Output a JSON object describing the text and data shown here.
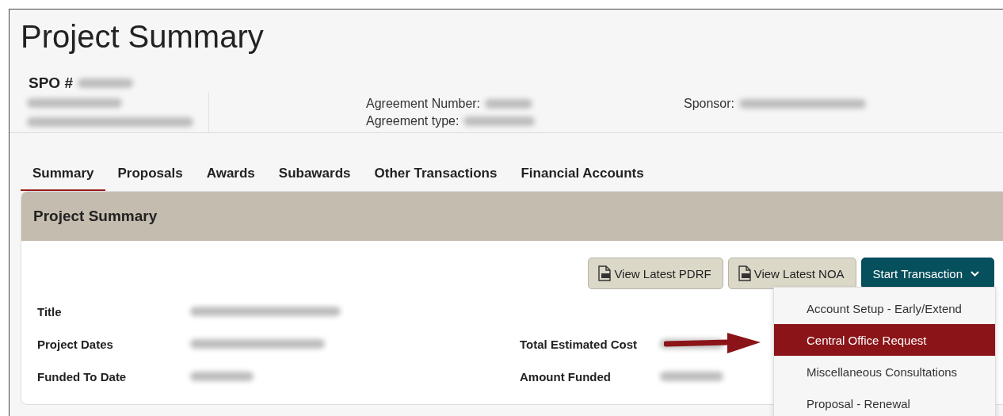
{
  "page": {
    "title": "Project Summary"
  },
  "header": {
    "spo_label": "SPO #",
    "agreement_fields": [
      {
        "label": "Agreement Number:"
      },
      {
        "label": "Agreement type:"
      }
    ],
    "sponsor_label": "Sponsor:"
  },
  "tabs": [
    {
      "label": "Summary",
      "selected": true
    },
    {
      "label": "Proposals",
      "selected": false
    },
    {
      "label": "Awards",
      "selected": false
    },
    {
      "label": "Subawards",
      "selected": false
    },
    {
      "label": "Other Transactions",
      "selected": false
    },
    {
      "label": "Financial Accounts",
      "selected": false
    }
  ],
  "panel": {
    "title": "Project Summary",
    "buttons": [
      {
        "label": "View Latest PDRF",
        "kind": "pdf"
      },
      {
        "label": "View Latest NOA",
        "kind": "pdf"
      },
      {
        "label": "Start Transaction",
        "kind": "dropdown"
      }
    ],
    "left_fields": [
      {
        "label": "Title"
      },
      {
        "label": "Project Dates"
      },
      {
        "label": "Funded To Date"
      }
    ],
    "right_fields": [
      {
        "label": "Total Estimated Cost"
      },
      {
        "label": "Amount Funded"
      }
    ]
  },
  "dropdown_menu": [
    {
      "label": "Account Setup - Early/Extend",
      "selected": false
    },
    {
      "label": "Central Office Request",
      "selected": true
    },
    {
      "label": "Miscellaneous Consultations",
      "selected": false
    },
    {
      "label": "Proposal - Renewal",
      "selected": false
    }
  ]
}
